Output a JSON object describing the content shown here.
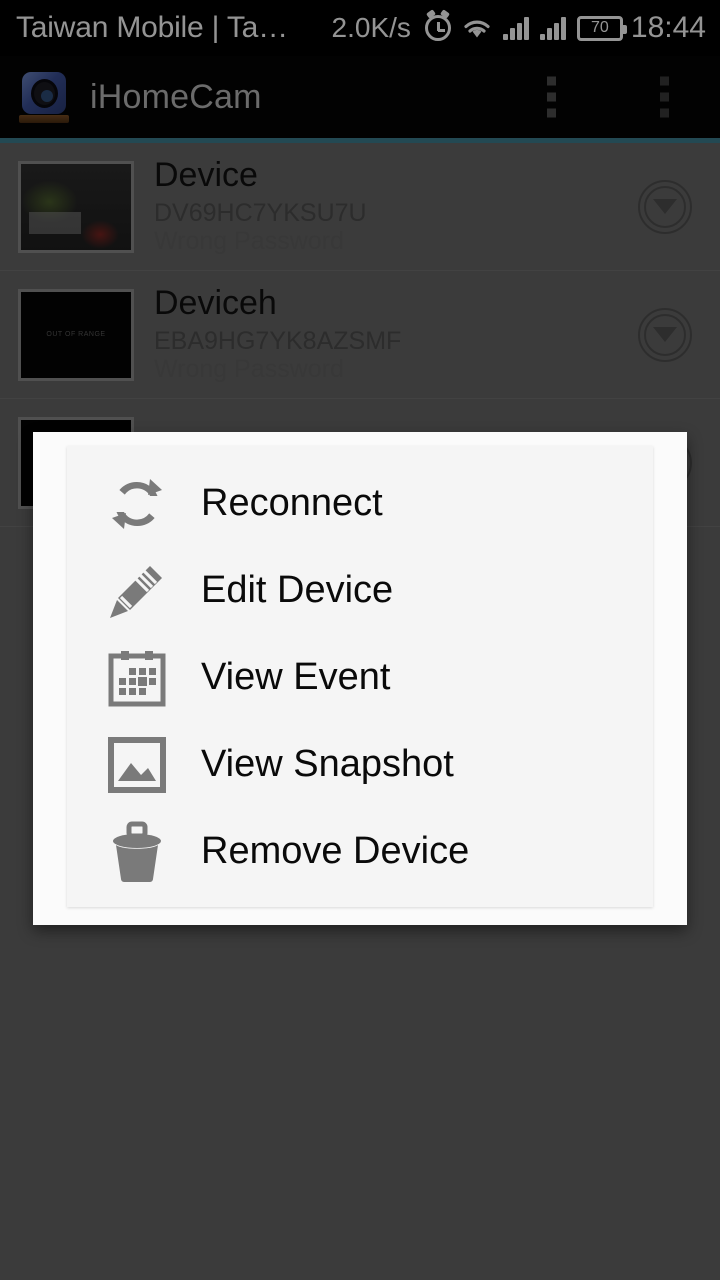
{
  "status_bar": {
    "carrier": "Taiwan Mobile | Ta…",
    "network_speed": "2.0K/s",
    "alarm_icon": "alarm-clock-icon",
    "wifi_icon": "wifi-icon",
    "signal_icon_1": "signal-bars-icon",
    "signal_icon_2": "signal-bars-icon",
    "battery_level": "70",
    "time": "18:44"
  },
  "app_bar": {
    "logo_icon": "camera-app-logo-icon",
    "title": "iHomeCam",
    "overflow_1_icon": "overflow-menu-icon",
    "overflow_2_icon": "overflow-menu-icon",
    "accent_color": "#3d7e90",
    "background_color": "#050505"
  },
  "device_list": {
    "rows": [
      {
        "name": "Device",
        "uid": "DV69HC7YKSU7U",
        "status": "Wrong Password",
        "thumbnail": "room-snapshot-thumbnail",
        "expand_icon": "chevron-down-circle-icon"
      },
      {
        "name": "Deviceh",
        "uid": "EBA9HG7YK8AZSMF",
        "status": "Wrong Password",
        "thumbnail": "out-of-range-thumbnail",
        "thumbnail_text": "OUT OF RANGE",
        "expand_icon": "chevron-down-circle-icon"
      },
      {
        "name": "",
        "uid": "",
        "status": "",
        "thumbnail": "offline-thumbnail",
        "expand_icon": "chevron-down-circle-icon"
      }
    ]
  },
  "dialog": {
    "items": [
      {
        "label": "Reconnect",
        "icon": "refresh-icon"
      },
      {
        "label": "Edit Device",
        "icon": "pencil-icon"
      },
      {
        "label": "View Event",
        "icon": "calendar-icon"
      },
      {
        "label": "View Snapshot",
        "icon": "image-icon"
      },
      {
        "label": "Remove Device",
        "icon": "trash-icon"
      }
    ]
  },
  "colors": {
    "scrim": "#666666",
    "dialog_background": "#f5f5f5",
    "icon_gray": "#7a7a7a",
    "accent": "#3d7e90"
  }
}
